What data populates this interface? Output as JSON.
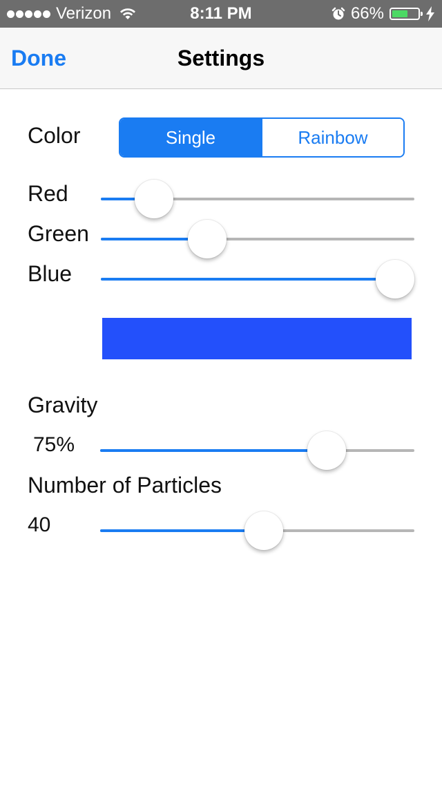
{
  "status_bar": {
    "carrier": "Verizon",
    "time": "8:11 PM",
    "battery_percent": "66%",
    "battery_level": 0.66,
    "battery_color": "#4cd964"
  },
  "nav": {
    "done_label": "Done",
    "title": "Settings"
  },
  "color": {
    "label": "Color",
    "segments": [
      "Single",
      "Rainbow"
    ],
    "selected": "Single",
    "accent": "#1a7cf2"
  },
  "rgb": {
    "red": {
      "label": "Red",
      "value": 0.17
    },
    "green": {
      "label": "Green",
      "value": 0.34
    },
    "blue": {
      "label": "Blue",
      "value": 1.0
    },
    "preview_color": "#2350fb"
  },
  "gravity": {
    "label": "Gravity",
    "value_text": "75%",
    "value": 0.72
  },
  "particles": {
    "label": "Number of Particles",
    "value_text": "40",
    "value": 0.52
  }
}
